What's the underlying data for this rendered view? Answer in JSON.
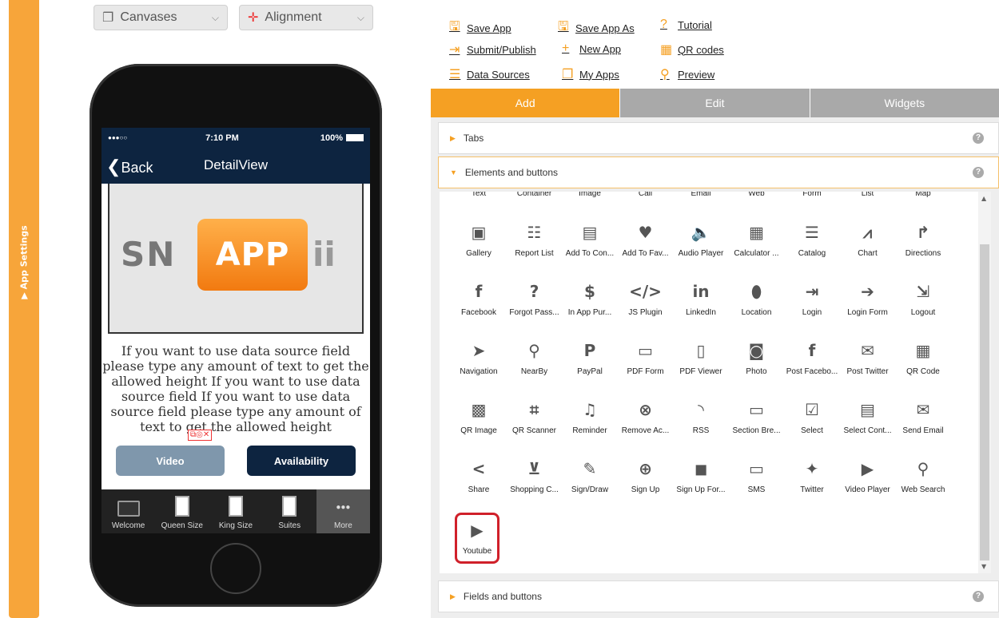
{
  "sidebar": {
    "label": "▶ App Settings"
  },
  "toolbar": {
    "canvases": "Canvases",
    "alignment": "Alignment",
    "links": [
      {
        "label": "Save App",
        "icon": "save-icon",
        "glyph": "🖫"
      },
      {
        "label": "Save App As",
        "icon": "save-as-icon",
        "glyph": "🖫"
      },
      {
        "label": "Tutorial",
        "icon": "help-icon",
        "glyph": "?"
      },
      {
        "label": "Submit/Publish",
        "icon": "publish-icon",
        "glyph": "⇥"
      },
      {
        "label": "New App",
        "icon": "plus-icon",
        "glyph": "+"
      },
      {
        "label": "QR codes",
        "icon": "qr-icon",
        "glyph": "▦"
      },
      {
        "label": "Data Sources",
        "icon": "database-icon",
        "glyph": "☰"
      },
      {
        "label": "My Apps",
        "icon": "copy-icon",
        "glyph": "❐"
      },
      {
        "label": "Preview",
        "icon": "search-icon",
        "glyph": "⚲"
      }
    ]
  },
  "phone": {
    "status_carrier": "●●●○○",
    "status_time": "7:10 PM",
    "status_battery": "100%",
    "back_label": "Back",
    "title": "DetailView",
    "logo": {
      "left": "SN",
      "center": "APP",
      "right": "ii"
    },
    "body_text": "If you want to use data source field please type any amount of text to get the allowed height If you want to use data source field If you want to use data source field please type any amount of text to get the allowed height",
    "buttons": [
      {
        "label": "Video"
      },
      {
        "label": "Availability"
      }
    ],
    "tabs": [
      {
        "label": "Welcome"
      },
      {
        "label": "Queen Size"
      },
      {
        "label": "King Size"
      },
      {
        "label": "Suites"
      },
      {
        "label": "More"
      }
    ]
  },
  "panel": {
    "tabs": [
      {
        "label": "Add"
      },
      {
        "label": "Edit"
      },
      {
        "label": "Widgets"
      }
    ],
    "sections": {
      "tabs": "Tabs",
      "elements": "Elements and buttons",
      "fields": "Fields and buttons"
    },
    "top_row": [
      "Text",
      "Container",
      "Image",
      "Call",
      "Email",
      "Web",
      "Form",
      "List",
      "Map"
    ],
    "items": [
      {
        "label": "Gallery",
        "glyph": "▣"
      },
      {
        "label": "Report List",
        "glyph": "☷"
      },
      {
        "label": "Add To Con...",
        "glyph": "▤"
      },
      {
        "label": "Add To Fav...",
        "glyph": "♥"
      },
      {
        "label": "Audio Player",
        "glyph": "🔈"
      },
      {
        "label": "Calculator ...",
        "glyph": "▦"
      },
      {
        "label": "Catalog",
        "glyph": "☰"
      },
      {
        "label": "Chart",
        "glyph": "⩘"
      },
      {
        "label": "Directions",
        "glyph": "↱"
      },
      {
        "label": "Facebook",
        "glyph": "f"
      },
      {
        "label": "Forgot Pass...",
        "glyph": "?"
      },
      {
        "label": "In App Pur...",
        "glyph": "$"
      },
      {
        "label": "JS Plugin",
        "glyph": "</>"
      },
      {
        "label": "LinkedIn",
        "glyph": "in"
      },
      {
        "label": "Location",
        "glyph": "⬮"
      },
      {
        "label": "Login",
        "glyph": "⇥"
      },
      {
        "label": "Login Form",
        "glyph": "➔"
      },
      {
        "label": "Logout",
        "glyph": "⇲"
      },
      {
        "label": "Navigation",
        "glyph": "➤"
      },
      {
        "label": "NearBy",
        "glyph": "⚲"
      },
      {
        "label": "PayPal",
        "glyph": "P"
      },
      {
        "label": "PDF Form",
        "glyph": "▭"
      },
      {
        "label": "PDF Viewer",
        "glyph": "▯"
      },
      {
        "label": "Photo",
        "glyph": "◙"
      },
      {
        "label": "Post Facebo...",
        "glyph": "f"
      },
      {
        "label": "Post Twitter",
        "glyph": "✉"
      },
      {
        "label": "QR Code",
        "glyph": "▦"
      },
      {
        "label": "QR Image",
        "glyph": "▩"
      },
      {
        "label": "QR Scanner",
        "glyph": "⌗"
      },
      {
        "label": "Reminder",
        "glyph": "♫"
      },
      {
        "label": "Remove Ac...",
        "glyph": "⊗"
      },
      {
        "label": "RSS",
        "glyph": "◝"
      },
      {
        "label": "Section Bre...",
        "glyph": "▭"
      },
      {
        "label": "Select",
        "glyph": "☑"
      },
      {
        "label": "Select Cont...",
        "glyph": "▤"
      },
      {
        "label": "Send Email",
        "glyph": "✉"
      },
      {
        "label": "Share",
        "glyph": "<"
      },
      {
        "label": "Shopping C...",
        "glyph": "⊻"
      },
      {
        "label": "Sign/Draw",
        "glyph": "✎"
      },
      {
        "label": "Sign Up",
        "glyph": "⊕"
      },
      {
        "label": "Sign Up For...",
        "glyph": "◼"
      },
      {
        "label": "SMS",
        "glyph": "▭"
      },
      {
        "label": "Twitter",
        "glyph": "✦"
      },
      {
        "label": "Video Player",
        "glyph": "▶"
      },
      {
        "label": "Web Search",
        "glyph": "⚲"
      },
      {
        "label": "Youtube",
        "glyph": "▶"
      }
    ]
  },
  "colors": {
    "accent": "#f5a023",
    "nav": "#0d2440",
    "tab_inactive": "#a9a9a9"
  }
}
